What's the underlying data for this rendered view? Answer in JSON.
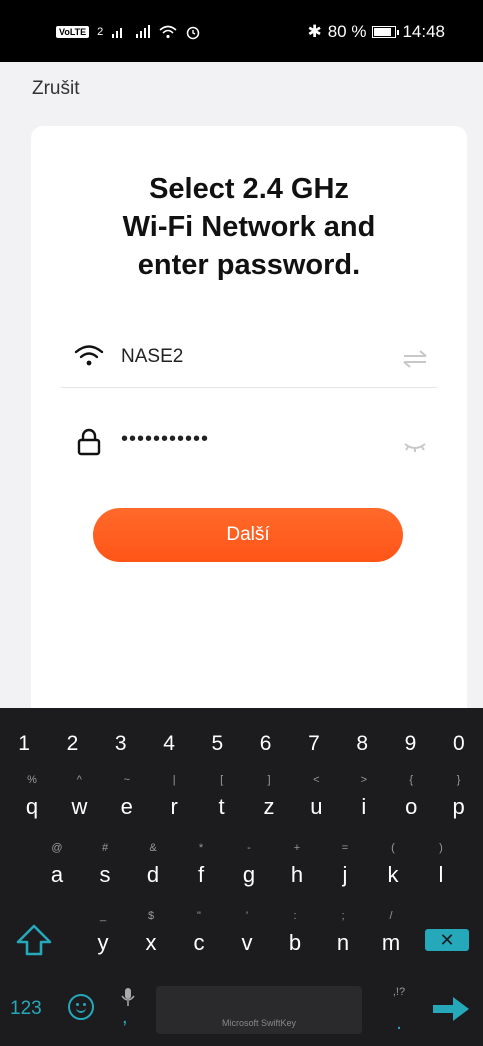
{
  "status_bar": {
    "volte": "VoLTE",
    "sim": "2",
    "bluetooth": "✱",
    "battery_percent": "80 %",
    "battery_level": 0.8,
    "time": "14:48"
  },
  "cancel_label": "Zrušit",
  "card": {
    "title_line1": "Select 2.4 GHz",
    "title_line2": "Wi-Fi Network and",
    "title_line3": "enter password.",
    "wifi_name": "NASE2",
    "password_mask": "•••••••••••",
    "next_label": "Další"
  },
  "keyboard": {
    "numbers": [
      "1",
      "2",
      "3",
      "4",
      "5",
      "6",
      "7",
      "8",
      "9",
      "0"
    ],
    "row1": [
      {
        "hint": "%",
        "ch": "q"
      },
      {
        "hint": "^",
        "ch": "w"
      },
      {
        "hint": "~",
        "ch": "e"
      },
      {
        "hint": "|",
        "ch": "r"
      },
      {
        "hint": "[",
        "ch": "t"
      },
      {
        "hint": "]",
        "ch": "z"
      },
      {
        "hint": "<",
        "ch": "u"
      },
      {
        "hint": ">",
        "ch": "i"
      },
      {
        "hint": "{",
        "ch": "o"
      },
      {
        "hint": "}",
        "ch": "p"
      }
    ],
    "row2": [
      {
        "hint": "@",
        "ch": "a"
      },
      {
        "hint": "#",
        "ch": "s"
      },
      {
        "hint": "&",
        "ch": "d"
      },
      {
        "hint": "*",
        "ch": "f"
      },
      {
        "hint": "-",
        "ch": "g"
      },
      {
        "hint": "+",
        "ch": "h"
      },
      {
        "hint": "=",
        "ch": "j"
      },
      {
        "hint": "(",
        "ch": "k"
      },
      {
        "hint": ")",
        "ch": "l"
      }
    ],
    "row3": [
      {
        "hint": "_",
        "ch": "y"
      },
      {
        "hint": "$",
        "ch": "x"
      },
      {
        "hint": "\"",
        "ch": "c"
      },
      {
        "hint": "'",
        "ch": "v"
      },
      {
        "hint": ":",
        "ch": "b"
      },
      {
        "hint": ";",
        "ch": "n"
      },
      {
        "hint": "/",
        "ch": "m"
      }
    ],
    "numbers_key": "123",
    "comma": ",",
    "space_label": "Microsoft SwiftKey",
    "punct_hint": ",!?",
    "period": ".",
    "backspace": "✕",
    "accent_color": "#25a8b9"
  },
  "colors": {
    "button": "#ff5a1f"
  }
}
